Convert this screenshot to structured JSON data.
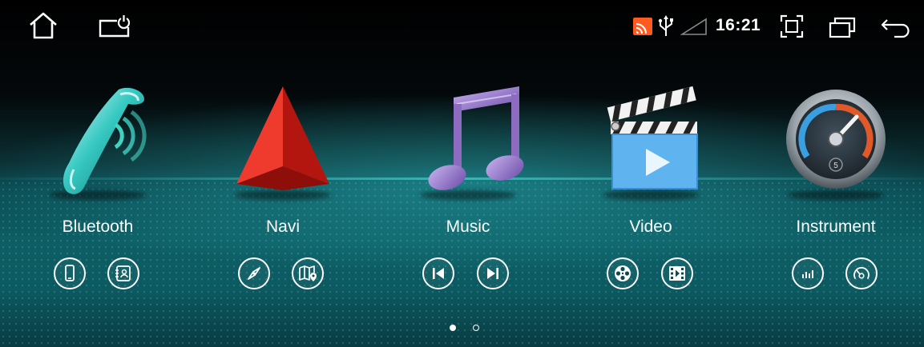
{
  "status_bar": {
    "time": "16:21",
    "left_icons": [
      "home-icon",
      "screen-power-icon"
    ],
    "right_icons": [
      "cast-icon",
      "usb-icon",
      "signal-icon",
      "screenshot-icon",
      "recent-apps-icon",
      "back-icon"
    ]
  },
  "apps": [
    {
      "label": "Bluetooth",
      "icon": "phone-handset-icon",
      "buttons": [
        "phone-icon",
        "contacts-icon"
      ]
    },
    {
      "label": "Navi",
      "icon": "navigation-arrow-icon",
      "buttons": [
        "compass-icon",
        "map-icon"
      ]
    },
    {
      "label": "Music",
      "icon": "music-note-icon",
      "buttons": [
        "previous-track-icon",
        "next-track-icon"
      ]
    },
    {
      "label": "Video",
      "icon": "clapperboard-icon",
      "buttons": [
        "film-reel-icon",
        "video-file-icon"
      ]
    },
    {
      "label": "Instrument",
      "icon": "gauge-icon",
      "buttons": [
        "equalizer-icon",
        "speedometer-icon"
      ]
    }
  ],
  "pagination": {
    "pages": 2,
    "current": 1
  },
  "colors": {
    "accent_teal": "#0d5e64",
    "navi_red": "#e02a22",
    "music_purple": "#8d6bc0",
    "video_blue": "#5fb4f0"
  }
}
